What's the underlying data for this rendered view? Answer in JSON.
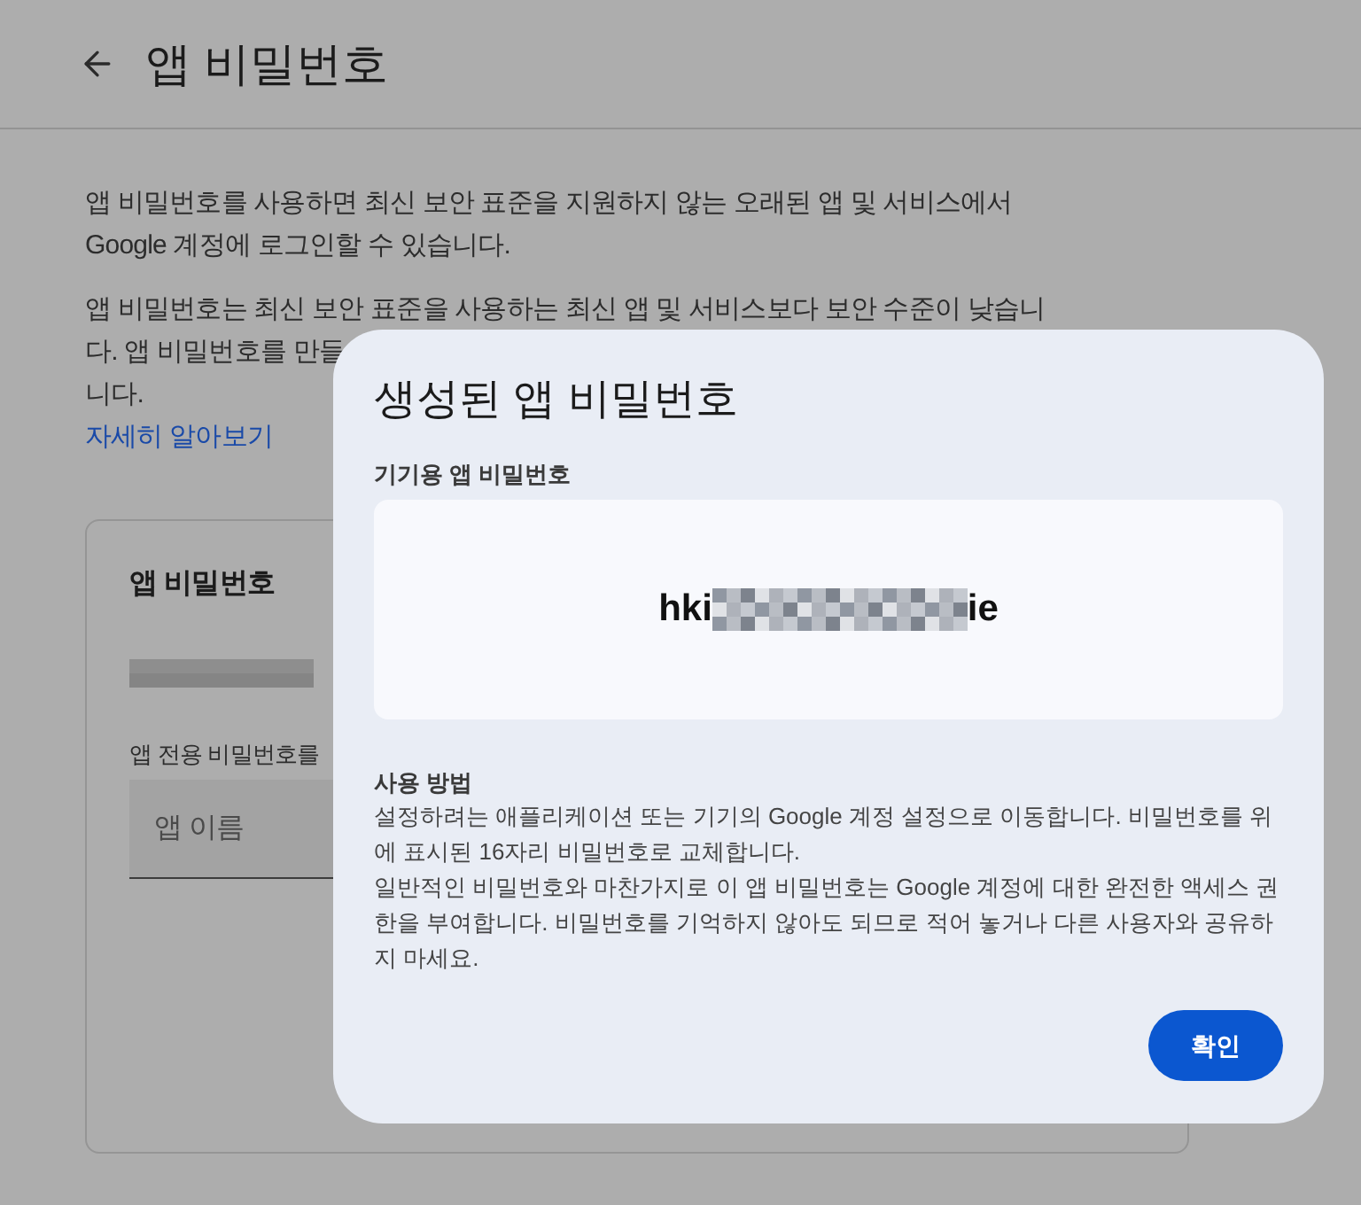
{
  "page": {
    "title": "앱 비밀번호",
    "intro": [
      "앱 비밀번호를 사용하면 최신 보안 표준을 지원하지 않는 오래된 앱 및 서비스에서",
      "Google 계정에 로그인할 수 있습니다."
    ],
    "warning": [
      "앱 비밀번호는 최신 보안 표준을 사용하는 최신 앱 및 서비스보다 보안 수준이 낮습니",
      "다. 앱 비밀번호를 만들",
      "니다."
    ],
    "learn_more": "자세히 알아보기",
    "card": {
      "title": "앱 비밀번호",
      "field_label": "앱 전용 비밀번호를",
      "field": {
        "placeholder": "앱 이름"
      }
    }
  },
  "dialog": {
    "title": "생성된 앱 비밀번호",
    "password_label": "기기용 앱 비밀번호",
    "password_start": "hki",
    "password_end": "ie",
    "howto_title": "사용 방법",
    "howto": [
      "설정하려는 애플리케이션 또는 기기의 Google 계정 설정으로 이동합니다. 비밀번호를 위에 표시된 16자리 비밀번호로 교체합니다.",
      "일반적인 비밀번호와 마찬가지로 이 앱 비밀번호는 Google 계정에 대한 완전한 액세스 권한을 부여합니다. 비밀번호를 기억하지 않아도 되므로 적어 놓거나 다른 사용자와 공유하지 마세요."
    ],
    "buttons": [
      "확인"
    ]
  }
}
